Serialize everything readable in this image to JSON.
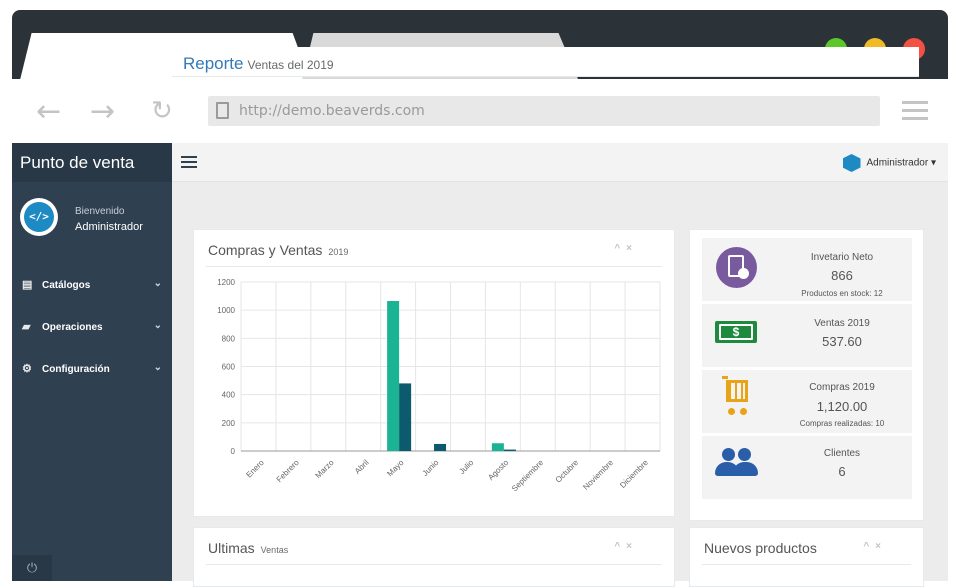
{
  "browser": {
    "url": "http://demo.beaverds.com",
    "traffic_colors": {
      "green": "#5cc72b",
      "yellow": "#f0b928",
      "red": "#f45044"
    }
  },
  "sidebar": {
    "brand": "Punto de venta",
    "welcome": "Bienvenido",
    "username": "Administrador",
    "items": [
      {
        "label": "Catálogos",
        "icon": "book-icon"
      },
      {
        "label": "Operaciones",
        "icon": "folder-icon"
      },
      {
        "label": "Configuración",
        "icon": "cogs-icon"
      }
    ]
  },
  "topbar": {
    "user_label": "Administrador ▾"
  },
  "page": {
    "title": "Reporte",
    "subtitle": "Ventas del 2019"
  },
  "chart_panel": {
    "title": "Compras y Ventas",
    "year": "2019"
  },
  "chart_data": {
    "type": "bar",
    "categories": [
      "Enero",
      "Febrero",
      "Marzo",
      "Abril",
      "Mayo",
      "Junio",
      "Julio",
      "Agosto",
      "Septiembre",
      "Octubre",
      "Noviembre",
      "Diciembre"
    ],
    "series": [
      {
        "values": [
          0,
          0,
          0,
          0,
          1065,
          0,
          0,
          55,
          0,
          0,
          0,
          0
        ],
        "color": "#1ab394"
      },
      {
        "values": [
          0,
          0,
          0,
          0,
          480,
          50,
          0,
          10,
          0,
          0,
          0,
          0
        ],
        "color": "#0b5a6e"
      }
    ],
    "ylim": [
      0,
      1200
    ],
    "yticks": [
      0,
      200,
      400,
      600,
      800,
      1000,
      1200
    ],
    "grid": true
  },
  "stats": [
    {
      "label": "Invetario Neto",
      "value": "866",
      "sub": "Productos en stock: 12",
      "icon": "clipboard-icon",
      "color": "#7a5a9e"
    },
    {
      "label": "Ventas 2019",
      "value": "537.60",
      "sub": "",
      "icon": "money-icon",
      "color": "#1e8a3e"
    },
    {
      "label": "Compras 2019",
      "value": "1,120.00",
      "sub": "Compras realizadas: 10",
      "icon": "cart-icon",
      "color": "#e8a317"
    },
    {
      "label": "Clientes",
      "value": "6",
      "sub": "",
      "icon": "users-icon",
      "color": "#2a5ea8"
    }
  ],
  "bottom_panels": {
    "ultimas": {
      "title": "Ultimas",
      "subtitle": "Ventas"
    },
    "nuevos": {
      "title": "Nuevos productos"
    }
  },
  "panel_tools": "^ ×"
}
